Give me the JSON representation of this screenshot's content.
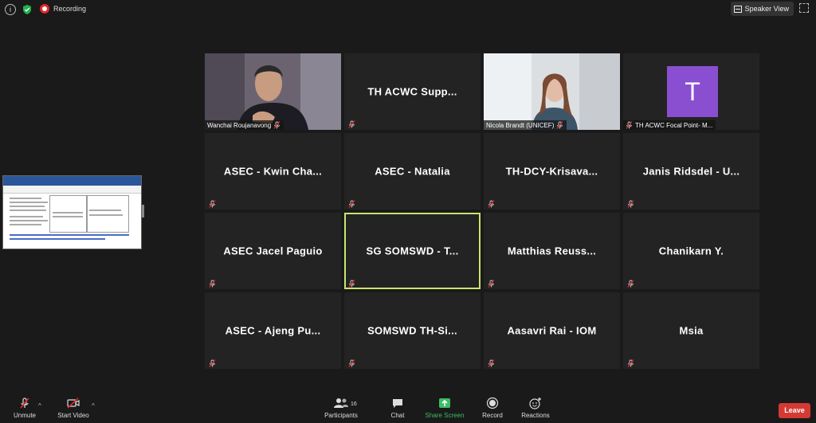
{
  "top": {
    "recording_label": "Recording",
    "speaker_view_label": "Speaker View"
  },
  "tiles": [
    {
      "id": "wanchai",
      "display_name": "",
      "caption": "Wanchai Roujanavong",
      "type": "video"
    },
    {
      "id": "th-acwc-supp",
      "display_name": "TH  ACWC  Supp...",
      "caption": "",
      "type": "name"
    },
    {
      "id": "nicola",
      "display_name": "",
      "caption": "Nicola Brandt (UNICEF)",
      "type": "video"
    },
    {
      "id": "th-acwc-focal",
      "display_name": "",
      "caption": "TH  ACWC Focal Point- M...",
      "type": "avatar",
      "avatar_letter": "T"
    },
    {
      "id": "kwin",
      "display_name": "ASEC  -  Kwin  Cha...",
      "caption": "",
      "type": "name"
    },
    {
      "id": "natalia",
      "display_name": "ASEC  -  Natalia",
      "caption": "",
      "type": "name"
    },
    {
      "id": "krisava",
      "display_name": "TH-DCY-Krisava...",
      "caption": "",
      "type": "name"
    },
    {
      "id": "janis",
      "display_name": "Janis  Ridsdel  -  U...",
      "caption": "",
      "type": "name"
    },
    {
      "id": "jacel",
      "display_name": "ASEC Jacel Paguio",
      "caption": "",
      "type": "name"
    },
    {
      "id": "somswd-t",
      "display_name": "SG  SOMSWD  -  T...",
      "caption": "",
      "type": "name",
      "active": true
    },
    {
      "id": "matthias",
      "display_name": "Matthias  Reuss...",
      "caption": "",
      "type": "name"
    },
    {
      "id": "chanikarn",
      "display_name": "Chanikarn  Y.",
      "caption": "",
      "type": "name"
    },
    {
      "id": "ajeng",
      "display_name": "ASEC  -  Ajeng  Pu...",
      "caption": "",
      "type": "name"
    },
    {
      "id": "somswd-th",
      "display_name": "SOMSWD  TH-Si...",
      "caption": "",
      "type": "name"
    },
    {
      "id": "aasavri",
      "display_name": "Aasavri  Rai  -  IOM",
      "caption": "",
      "type": "name"
    },
    {
      "id": "msia",
      "display_name": "Msia",
      "caption": "",
      "type": "name"
    }
  ],
  "toolbar": {
    "unmute_label": "Unmute",
    "start_video_label": "Start Video",
    "participants_label": "Participants",
    "participants_count": "16",
    "chat_label": "Chat",
    "share_screen_label": "Share Screen",
    "record_label": "Record",
    "reactions_label": "Reactions",
    "leave_label": "Leave"
  },
  "colors": {
    "active_speaker_border": "#c9e46f",
    "share_screen_green": "#3dbd63",
    "leave_red": "#d43a33",
    "avatar_purple": "#8a4fd0",
    "muted_red": "#e02828"
  }
}
